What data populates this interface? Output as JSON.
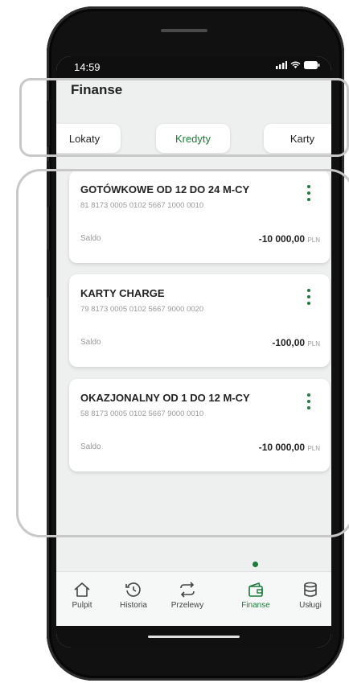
{
  "status": {
    "time": "14:59"
  },
  "page": {
    "title": "Finanse"
  },
  "tabs": [
    {
      "label": "Lokaty"
    },
    {
      "label": "Kredyty"
    },
    {
      "label": "Karty"
    }
  ],
  "cards": [
    {
      "name": "GOTÓWKOWE OD 12 DO 24 M-CY",
      "account": "81 8173 0005 0102 5667 1000 0010",
      "saldo_label": "Saldo",
      "amount": "-10 000,00",
      "currency": "PLN"
    },
    {
      "name": "KARTY CHARGE",
      "account": "79 8173 0005 0102 5667 9000 0020",
      "saldo_label": "Saldo",
      "amount": "-100,00",
      "currency": "PLN"
    },
    {
      "name": "OKAZJONALNY OD 1 DO 12 M-CY",
      "account": "58 8173 0005 0102 5667 9000 0010",
      "saldo_label": "Saldo",
      "amount": "-10 000,00",
      "currency": "PLN"
    }
  ],
  "nav": [
    {
      "label": "Pulpit",
      "icon": "home-icon"
    },
    {
      "label": "Historia",
      "icon": "history-icon"
    },
    {
      "label": "Przelewy",
      "icon": "transfer-icon"
    },
    {
      "label": "Finanse",
      "icon": "wallet-icon"
    },
    {
      "label": "Usługi",
      "icon": "database-icon"
    }
  ],
  "colors": {
    "accent": "#1e7a3c"
  }
}
